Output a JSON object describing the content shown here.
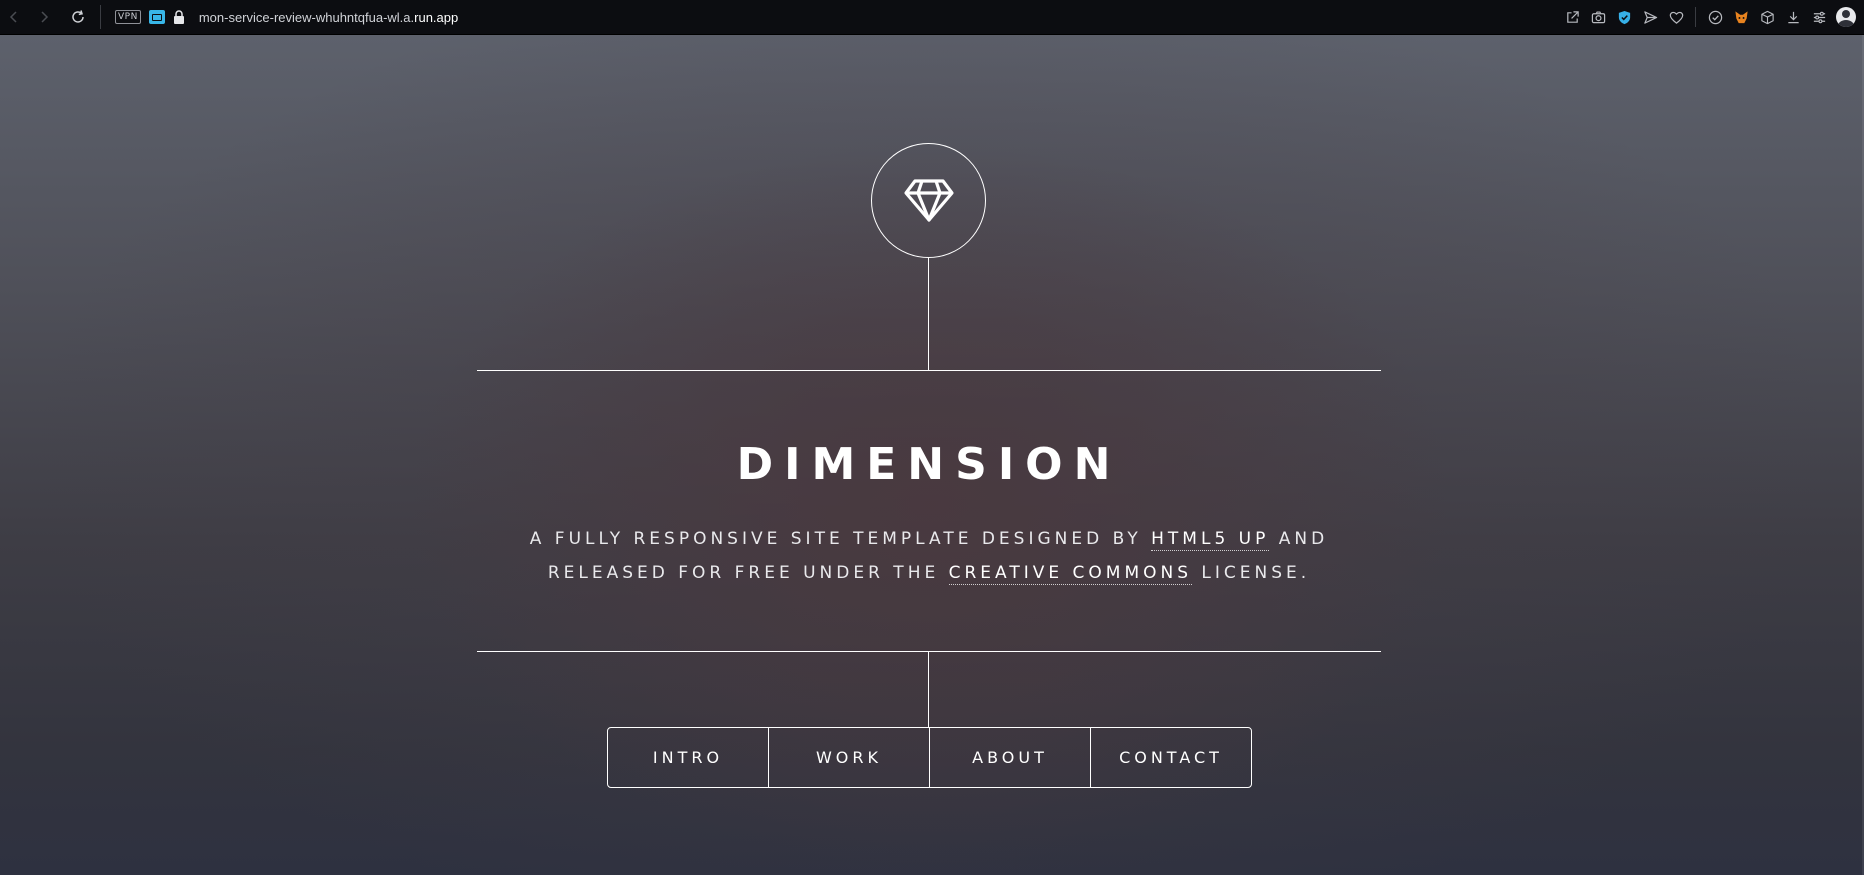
{
  "browser": {
    "url_prefix": "mon-service-review-whuhntqfua-wl.a.",
    "url_domain": "run.app",
    "vpn_label": "VPN"
  },
  "site": {
    "title": "DIMENSION",
    "tagline_part1": "A FULLY RESPONSIVE SITE TEMPLATE DESIGNED BY ",
    "link_html5up": "HTML5 UP",
    "tagline_part2": " AND RELEASED FOR FREE UNDER THE ",
    "link_cc": "CREATIVE COMMONS",
    "tagline_part3": " LICENSE.",
    "logo_icon": "diamond-icon"
  },
  "nav": {
    "items": [
      {
        "label": "INTRO"
      },
      {
        "label": "WORK"
      },
      {
        "label": "ABOUT"
      },
      {
        "label": "CONTACT"
      }
    ]
  }
}
